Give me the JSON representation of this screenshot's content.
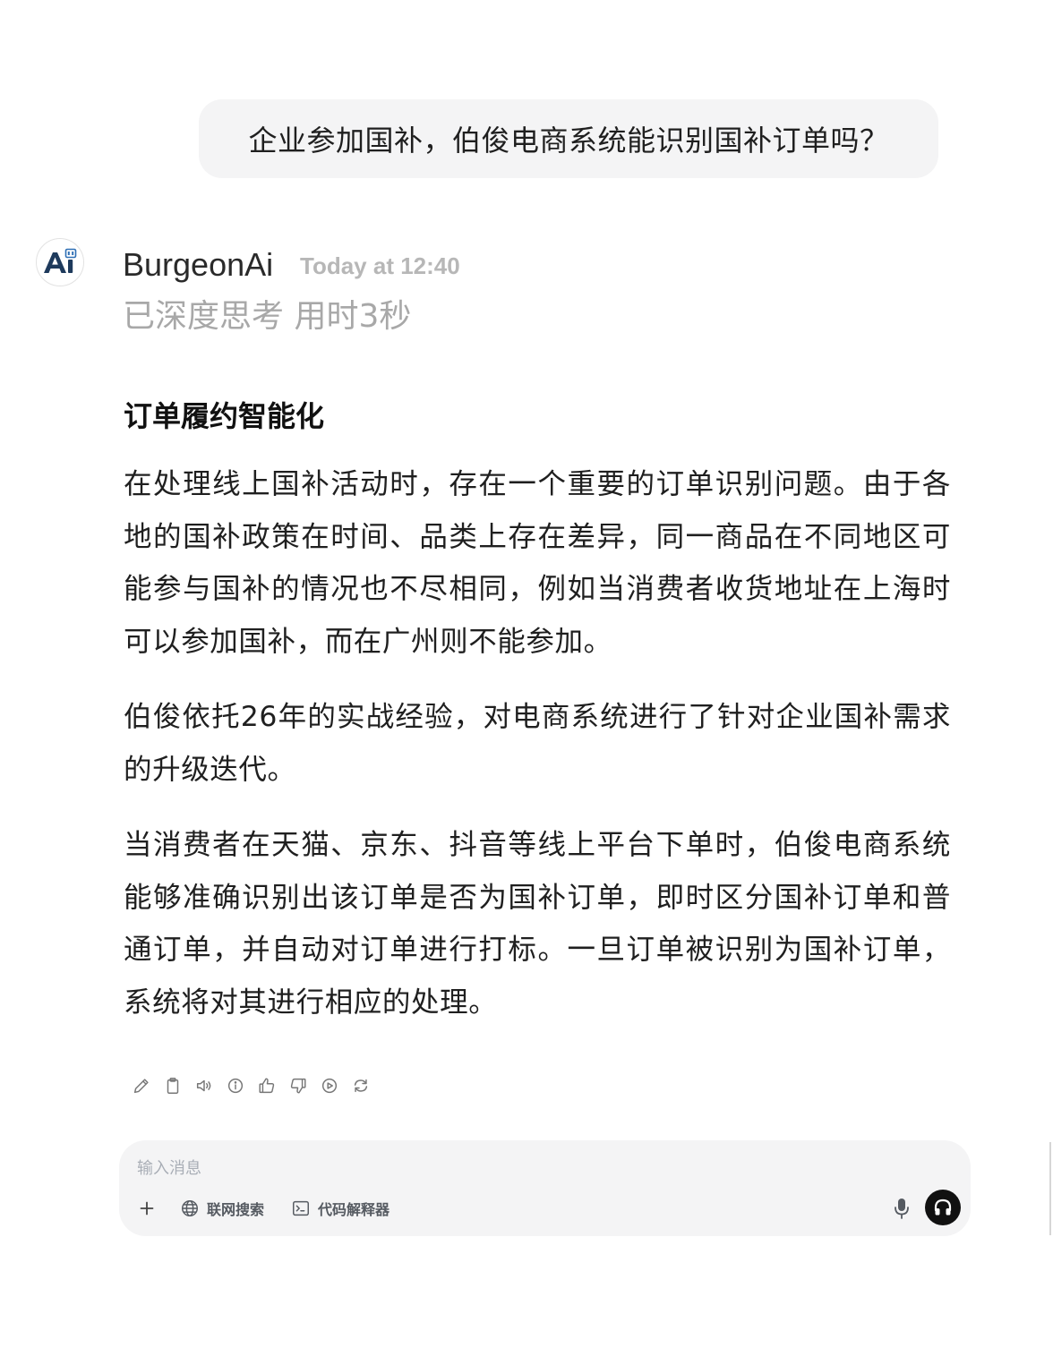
{
  "user_message": {
    "text": "企业参加国补，伯俊电商系统能识别国补订单吗？"
  },
  "assistant": {
    "name": "BurgeonAi",
    "timestamp": "Today at 12:40",
    "thinking_status": "已深度思考 用时3秒",
    "avatar_icon": "burgeon-ai-logo-icon",
    "brand_colors": {
      "dark": "#1e3a5c",
      "accent": "#2f6fb5"
    }
  },
  "answer": {
    "heading": "订单履约智能化",
    "paragraphs": [
      "在处理线上国补活动时，存在一个重要的订单识别问题。由于各地的国补政策在时间、品类上存在差异，同一商品在不同地区可能参与国补的情况也不尽相同，例如当消费者收货地址在上海时可以参加国补，而在广州则不能参加。",
      "伯俊依托26年的实战经验，对电商系统进行了针对企业国补需求的升级迭代。",
      "当消费者在天猫、京东、抖音等线上平台下单时，伯俊电商系统能够准确识别出该订单是否为国补订单，即时区分国补订单和普通订单，并自动对订单进行打标。一旦订单被识别为国补订单，系统将对其进行相应的处理。"
    ]
  },
  "actions": [
    {
      "name": "edit",
      "icon": "pencil-icon"
    },
    {
      "name": "copy",
      "icon": "clipboard-icon"
    },
    {
      "name": "read-aloud",
      "icon": "speaker-icon"
    },
    {
      "name": "info",
      "icon": "info-icon"
    },
    {
      "name": "thumbs-up",
      "icon": "thumbs-up-icon"
    },
    {
      "name": "thumbs-down",
      "icon": "thumbs-down-icon"
    },
    {
      "name": "continue",
      "icon": "play-circle-icon"
    },
    {
      "name": "regenerate",
      "icon": "refresh-icon"
    }
  ],
  "composer": {
    "placeholder": "输入消息",
    "web_search_label": "联网搜索",
    "code_interpreter_label": "代码解释器",
    "icons": {
      "add": "plus-icon",
      "web_search": "globe-icon",
      "code_interpreter": "terminal-icon",
      "mic": "microphone-icon",
      "voice": "headphones-icon"
    }
  },
  "colors": {
    "bubble_bg": "#f4f4f5",
    "muted_text": "#a8a8a8",
    "timestamp_text": "#b7b7b7",
    "placeholder_text": "#a9aeb6",
    "voice_button_bg": "#111111"
  }
}
